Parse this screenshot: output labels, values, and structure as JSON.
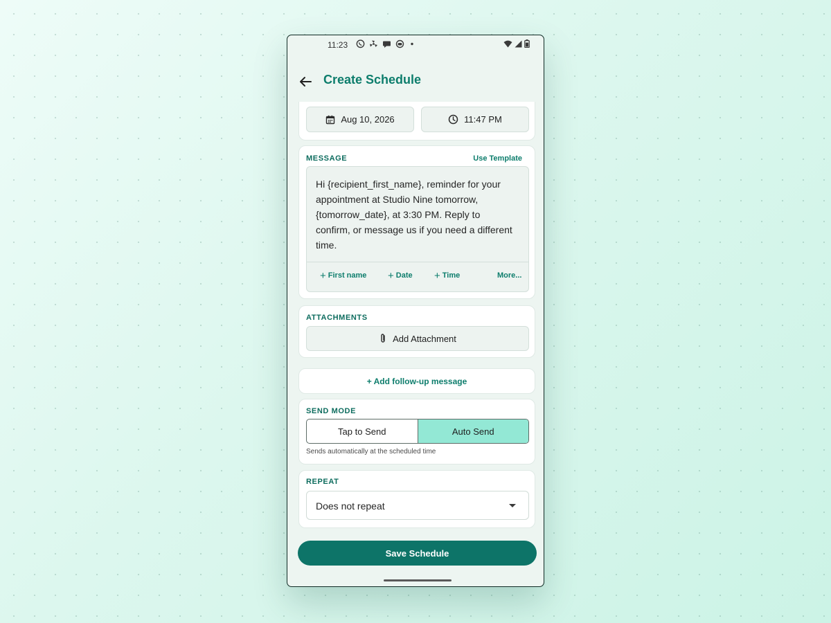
{
  "status_bar": {
    "time": "11:23"
  },
  "header": {
    "title": "Create Schedule"
  },
  "datetime": {
    "date": "Aug 10, 2026",
    "time": "11:47 PM"
  },
  "message": {
    "label": "MESSAGE",
    "template_link": "Use Template",
    "text": "Hi {recipient_first_name}, reminder for your appointment at Studio Nine tomorrow, {tomorrow_date}, at 3:30 PM. Reply to confirm, or message us if you need a different time.",
    "chips": [
      {
        "plus": "+",
        "label": "First name"
      },
      {
        "plus": "+",
        "label": "Date"
      },
      {
        "plus": "+",
        "label": "Time"
      }
    ],
    "more": "More..."
  },
  "attachments": {
    "label": "ATTACHMENTS",
    "button": "Add Attachment"
  },
  "followup": {
    "label": "+ Add follow-up message"
  },
  "send_mode": {
    "label": "SEND MODE",
    "options": [
      "Tap to Send",
      "Auto Send"
    ],
    "selected": "Auto Send",
    "hint": "Sends automatically at the scheduled time"
  },
  "repeat": {
    "label": "REPEAT",
    "value": "Does not repeat"
  },
  "save_button": "Save Schedule",
  "colors": {
    "accent": "#0d7d6c",
    "primary_button": "#0d7468",
    "selected_segment": "#93e8d5"
  }
}
